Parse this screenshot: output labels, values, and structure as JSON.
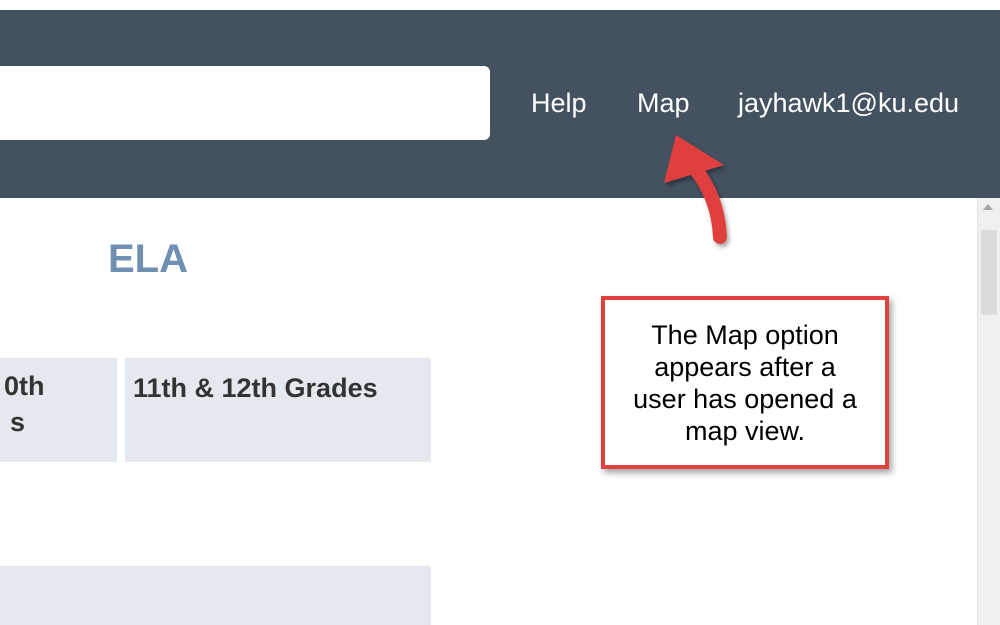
{
  "header": {
    "search": {
      "value": "",
      "placeholder": ""
    },
    "nav": {
      "help_label": "Help",
      "map_label": "Map",
      "user_label": "jayhawk1@ku.edu"
    }
  },
  "main": {
    "subject_title": "ELA",
    "grade_columns": [
      {
        "line1": "0th",
        "line2": "s"
      },
      {
        "label": "11th & 12th Grades"
      }
    ]
  },
  "annotation": {
    "callout_text": "The Map option appears after a user has opened a map view."
  },
  "colors": {
    "header_bg": "#435160",
    "title_color": "#6f8fb3",
    "cell_bg": "#e4e9f0",
    "callout_border": "#e0403e",
    "arrow_color": "#e0403e"
  },
  "icons": {
    "scroll_up": "scroll-up-arrow-icon",
    "annotation_arrow": "annotation-arrow-icon"
  }
}
